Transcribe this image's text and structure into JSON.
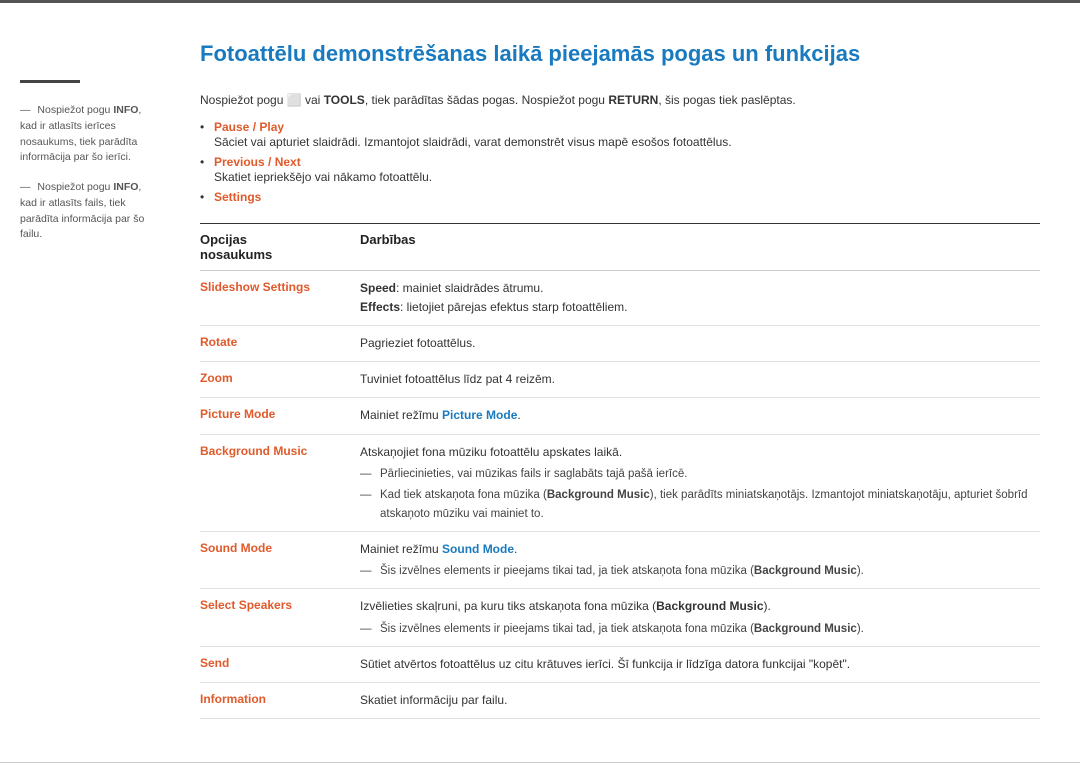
{
  "page": {
    "title": "Fotoattēlu demonstrēšanas laikā pieejamās pogas un funkcijas",
    "intro": "Nospiežot pogu  vai TOOLS, tiek parādītas šādas pogas. Nospiežot pogu RETURN, šis pogas tiek paslēptas.",
    "intro_tools": "TOOLS",
    "intro_return": "RETURN"
  },
  "sidebar": {
    "note1_text": "Nospiežot pogu ",
    "note1_bold": "INFO",
    "note1_rest": ", kad ir atlasīts ierīces nosaukums, tiek parādīta informācija par šo ierīci.",
    "note2_text": "Nospiežot pogu ",
    "note2_bold": "INFO",
    "note2_rest": ", kad ir atlasīts fails, tiek parādīta informācija par šo failu."
  },
  "bullets": [
    {
      "title": "Pause / Play",
      "desc": "Sāciet vai apturiet slaidrādi. Izmantojot slaidrādi, varat demonstrēt visus mapē esošos fotoattēlus."
    },
    {
      "title": "Previous / Next",
      "desc": "Skatiet iepriekšējo vai nākamo fotoattēlu."
    },
    {
      "title": "Settings",
      "desc": ""
    }
  ],
  "table": {
    "col1_header": "Opcijas nosaukums",
    "col2_header": "Darbības",
    "rows": [
      {
        "option": "Slideshow Settings",
        "action": "Speed: mainiet slaidrādes ātrumu.\nEffects: lietojiet pārejas efektus starp fotoattēliem.",
        "action_parts": [
          {
            "bold": "Speed",
            "text": ": mainiet slaidrādes ātrumu."
          },
          {
            "bold": "Effects",
            "text": ": lietojiet pārejas efektus starp fotoattēliem."
          }
        ]
      },
      {
        "option": "Rotate",
        "action": "Pagrieziet fotoattēlus."
      },
      {
        "option": "Zoom",
        "action": "Tuviniet fotoattēlus līdz pat 4 reizēm."
      },
      {
        "option": "Picture Mode",
        "action": "Mainiet režīmu Picture Mode.",
        "action_highlight": "Picture Mode"
      },
      {
        "option": "Background Music",
        "action": "Atskaņojiet fona mūziku fotoattēlu apskates laikā.",
        "subnotes": [
          "Pārliecinieties, vai mūzikas fails ir saglabāts tajā pašā ierīcē.",
          "Kad tiek atskaņota fona mūzika (Background Music), tiek parādīts miniatskaņotājs. Izmantojot miniatskaņotāju, apturiet šobrīd atskaņoto mūziku vai mainiet to."
        ],
        "subnote_highlights": [
          "Background Music"
        ]
      },
      {
        "option": "Sound Mode",
        "action": "Mainiet režīmu Sound Mode.",
        "action_highlight": "Sound Mode",
        "subnotes": [
          "Šis izvēlnes elements ir pieejams tikai tad, ja tiek atskaņota fona mūzika (Background Music)."
        ],
        "subnote_highlights": [
          "Background Music"
        ]
      },
      {
        "option": "Select Speakers",
        "action": "Izvēlieties skaļruni, pa kuru tiks atskaņota fona mūzika (Background Music).",
        "action_highlight": "Background Music",
        "subnotes": [
          "Šis izvēlnes elements ir pieejams tikai tad, ja tiek atskaņota fona mūzika (Background Music)."
        ],
        "subnote_highlights": [
          "Background Music"
        ]
      },
      {
        "option": "Send",
        "action": "Sūtiet atvērtos fotoattēlus uz citu krātuves ierīci. Šī funkcija ir līdzīga datora funkcijai \"kopēt\"."
      },
      {
        "option": "Information",
        "action": "Skatiet informāciju par failu."
      }
    ]
  }
}
